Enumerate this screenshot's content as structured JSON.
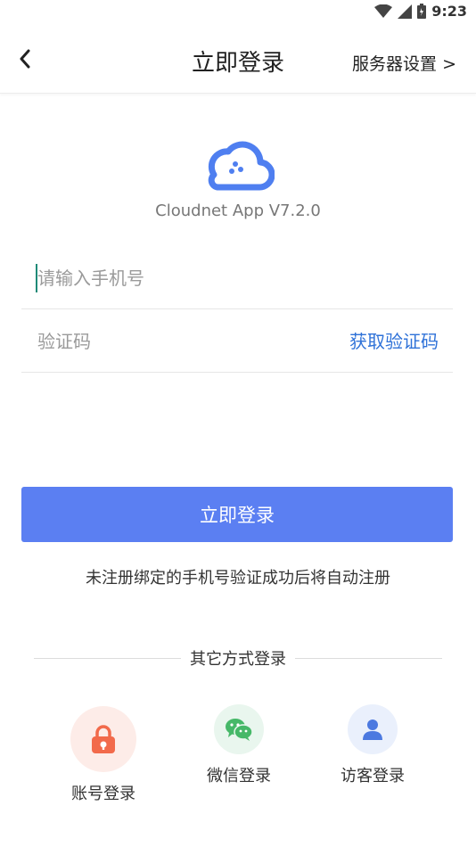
{
  "status_bar": {
    "time": "9:23"
  },
  "header": {
    "title": "立即登录",
    "server_settings_label": "服务器设置 >"
  },
  "app": {
    "version_label": "Cloudnet App V7.2.0"
  },
  "form": {
    "phone_placeholder": "请输入手机号",
    "code_placeholder": "验证码",
    "get_code_label": "获取验证码"
  },
  "login_button_label": "立即登录",
  "notice": "未注册绑定的手机号验证成功后将自动注册",
  "other_methods": {
    "heading": "其它方式登录",
    "items": [
      {
        "label": "账号登录",
        "icon": "lock-icon",
        "bg": "#fdece8",
        "color": "#f26a4b"
      },
      {
        "label": "微信登录",
        "icon": "wechat-icon",
        "bg": "#e9f6ee",
        "color": "#46b868"
      },
      {
        "label": "访客登录",
        "icon": "user-icon",
        "bg": "#eaf0fc",
        "color": "#4c79e0"
      }
    ]
  },
  "colors": {
    "accent": "#5b7ff2",
    "link": "#2f72d8"
  }
}
